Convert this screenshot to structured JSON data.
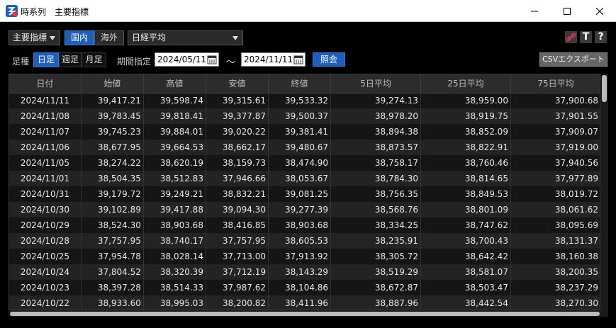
{
  "window": {
    "title": "時系列　主要指標",
    "accent": "#1f5fb8"
  },
  "toolbar": {
    "category_select": "主要指標",
    "region_tabs": [
      "国内",
      "海外"
    ],
    "region_active": "国内",
    "index_select": "日経平均",
    "icons": [
      "link-icon",
      "text-icon",
      "help-icon"
    ],
    "help_label": "?",
    "text_label": "T"
  },
  "filter": {
    "bar_type_label": "足種",
    "bar_types": [
      "日足",
      "週足",
      "月足"
    ],
    "bar_type_active": "日足",
    "period_label": "期間指定",
    "date_from": "2024/05/11",
    "tilde": "～",
    "date_to": "2024/11/11",
    "query_button": "照会",
    "csv_button": "CSVエクスポート"
  },
  "table": {
    "columns": [
      "日付",
      "始値",
      "高値",
      "安値",
      "終値",
      "5日平均",
      "25日平均",
      "75日平均"
    ],
    "rows": [
      [
        "2024/11/11",
        "39,417.21",
        "39,598.74",
        "39,315.61",
        "39,533.32",
        "39,274.13",
        "38,959.00",
        "37,900.68"
      ],
      [
        "2024/11/08",
        "39,783.45",
        "39,818.41",
        "39,377.87",
        "39,500.37",
        "38,978.20",
        "38,919.75",
        "37,901.55"
      ],
      [
        "2024/11/07",
        "39,745.23",
        "39,884.01",
        "39,020.22",
        "39,381.41",
        "38,894.38",
        "38,852.09",
        "37,909.07"
      ],
      [
        "2024/11/06",
        "38,677.95",
        "39,664.53",
        "38,662.17",
        "39,480.67",
        "38,873.57",
        "38,822.91",
        "37,919.00"
      ],
      [
        "2024/11/05",
        "38,274.22",
        "38,620.19",
        "38,159.73",
        "38,474.90",
        "38,758.17",
        "38,760.46",
        "37,940.56"
      ],
      [
        "2024/11/01",
        "38,504.35",
        "38,512.83",
        "37,946.66",
        "38,053.67",
        "38,784.30",
        "38,814.65",
        "37,977.89"
      ],
      [
        "2024/10/31",
        "39,179.72",
        "39,249.21",
        "38,832.21",
        "39,081.25",
        "38,756.35",
        "38,849.53",
        "38,019.72"
      ],
      [
        "2024/10/30",
        "39,102.89",
        "39,417.88",
        "39,094.30",
        "39,277.39",
        "38,568.76",
        "38,801.09",
        "38,061.62"
      ],
      [
        "2024/10/29",
        "38,524.30",
        "38,903.68",
        "38,416.85",
        "38,903.68",
        "38,334.25",
        "38,747.62",
        "38,095.69"
      ],
      [
        "2024/10/28",
        "37,757.95",
        "38,740.17",
        "37,757.95",
        "38,605.53",
        "38,235.91",
        "38,700.43",
        "38,131.37"
      ],
      [
        "2024/10/25",
        "37,954.78",
        "38,028.14",
        "37,713.00",
        "37,913.92",
        "38,305.72",
        "38,642.42",
        "38,160.38"
      ],
      [
        "2024/10/24",
        "37,804.52",
        "38,320.39",
        "37,712.19",
        "38,143.29",
        "38,519.29",
        "38,581.07",
        "38,200.35"
      ],
      [
        "2024/10/23",
        "38,397.28",
        "38,514.33",
        "37,987.62",
        "38,104.86",
        "38,672.87",
        "38,503.47",
        "38,237.29"
      ],
      [
        "2024/10/22",
        "38,933.60",
        "38,995.03",
        "38,200.82",
        "38,411.96",
        "38,887.96",
        "38,442.54",
        "38,270.30"
      ]
    ]
  }
}
